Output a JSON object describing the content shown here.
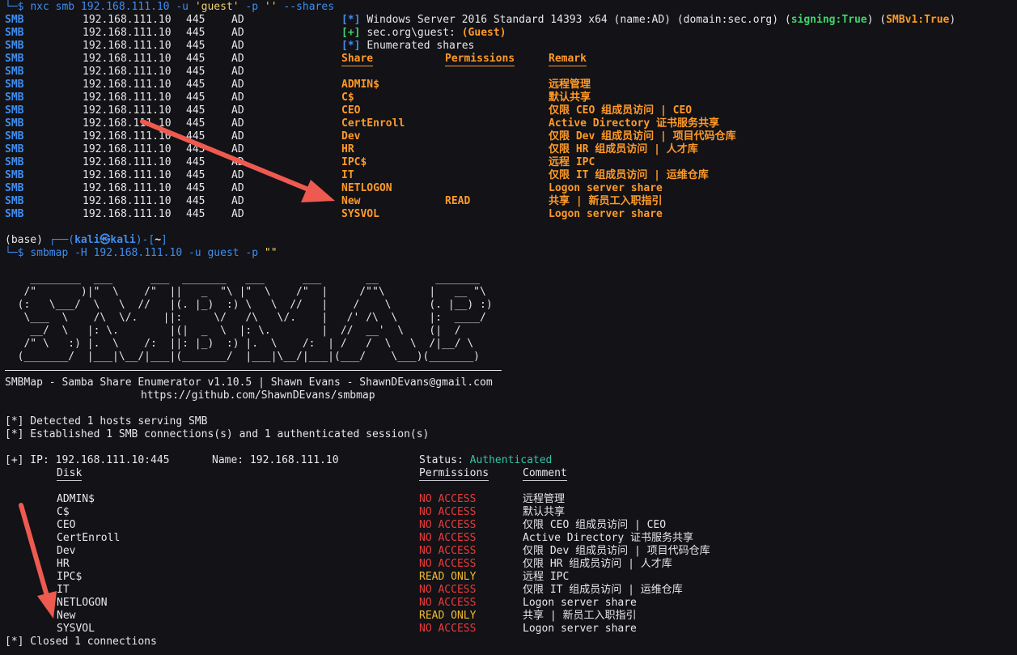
{
  "cmd1": {
    "prompt": "└─$ ",
    "command": "nxc smb 192.168.111.10 -u ",
    "user_arg": "'guest'",
    "mid": " -p ",
    "pass_arg": "''",
    "tail": " --shares"
  },
  "smb_proto": "SMB",
  "smb_ip": "192.168.111.10",
  "smb_port": "445",
  "smb_host": "AD",
  "nxc": {
    "info_tag": "[*]",
    "os_text": "Windows Server 2016 Standard 14393 x64 (name:AD) (domain:sec.org) (",
    "signing": "signing:True",
    "sep": ") (",
    "smbv1": "SMBv1:True",
    "close": ")",
    "plus_tag": "[+]",
    "login": "sec.org\\guest: ",
    "guest": "(Guest)",
    "enum_tag": "[*]",
    "enum": "Enumerated shares",
    "headers": [
      "Share",
      "Permissions",
      "Remark"
    ],
    "shares": [
      {
        "share": "ADMIN$",
        "perm": "",
        "remark": "远程管理"
      },
      {
        "share": "C$",
        "perm": "",
        "remark": "默认共享"
      },
      {
        "share": "CEO",
        "perm": "",
        "remark": "仅限 CEO 组成员访问 | CEO"
      },
      {
        "share": "CertEnroll",
        "perm": "",
        "remark": "Active Directory 证书服务共享"
      },
      {
        "share": "Dev",
        "perm": "",
        "remark": "仅限 Dev 组成员访问 | 项目代码仓库"
      },
      {
        "share": "HR",
        "perm": "",
        "remark": "仅限 HR 组成员访问 | 人才库"
      },
      {
        "share": "IPC$",
        "perm": "",
        "remark": "远程 IPC"
      },
      {
        "share": "IT",
        "perm": "",
        "remark": "仅限 IT 组成员访问 | 运维仓库"
      },
      {
        "share": "NETLOGON",
        "perm": "",
        "remark": "Logon server share"
      },
      {
        "share": "New",
        "perm": "READ",
        "remark": "共享 | 新员工入职指引"
      },
      {
        "share": "SYSVOL",
        "perm": "",
        "remark": "Logon server share"
      }
    ]
  },
  "prompt2": {
    "base": "(base) ",
    "open": "┌──(",
    "user": "kali㉿kali",
    "close": ")-[",
    "dir": "~",
    "end": "]",
    "arrow": "└─$ ",
    "command": "smbmap -H 192.168.111.10 -u guest -p ",
    "arg": "\"\""
  },
  "banner": [
    "    ________  ___      ___  _______   ___      ___       __         _______",
    "   /\"       )|\"  \\    /\"  ||   _  \"\\ |\"  \\    /\"  |     /\"\"\\       |   __ \"\\",
    "  (:   \\___/  \\   \\  //   |(. |_)  :) \\   \\  //   |    /    \\      (. |__) :)",
    "   \\___  \\    /\\  \\/.    ||:     \\/   /\\   \\/.    |   /' /\\  \\     |:  ____/",
    "    __/  \\   |: \\.        |(|  _  \\  |: \\.        |  //  __'  \\    (|  /",
    "   /\" \\   :) |.  \\    /:  ||: |_)  :) |.  \\    /:  | /   /  \\   \\  /|__/ \\",
    "  (_______/  |___|\\__/|___|(_______/  |___|\\__/|___|(___/    \\___)(_______)"
  ],
  "smbmap": {
    "title": "SMBMap - Samba Share Enumerator v1.10.5 | Shawn Evans - ShawnDEvans@gmail.com",
    "url": "https://github.com/ShawnDEvans/smbmap",
    "detected": "[*] Detected 1 hosts serving SMB",
    "established": "[*] Established 1 SMB connections(s) and 1 authenticated session(s)",
    "ip_line": "[+] IP: 192.168.111.10:445",
    "name_line": "Name: 192.168.111.10",
    "status_label": "Status: ",
    "status_value": "Authenticated",
    "headers": [
      "Disk",
      "Permissions",
      "Comment"
    ],
    "shares": [
      {
        "disk": "ADMIN$",
        "perm": "NO ACCESS",
        "comment": "远程管理"
      },
      {
        "disk": "C$",
        "perm": "NO ACCESS",
        "comment": "默认共享"
      },
      {
        "disk": "CEO",
        "perm": "NO ACCESS",
        "comment": "仅限 CEO 组成员访问 | CEO"
      },
      {
        "disk": "CertEnroll",
        "perm": "NO ACCESS",
        "comment": "Active Directory 证书服务共享"
      },
      {
        "disk": "Dev",
        "perm": "NO ACCESS",
        "comment": "仅限 Dev 组成员访问 | 项目代码仓库"
      },
      {
        "disk": "HR",
        "perm": "NO ACCESS",
        "comment": "仅限 HR 组成员访问 | 人才库"
      },
      {
        "disk": "IPC$",
        "perm": "READ ONLY",
        "comment": "远程 IPC"
      },
      {
        "disk": "IT",
        "perm": "NO ACCESS",
        "comment": "仅限 IT 组成员访问 | 运维仓库"
      },
      {
        "disk": "NETLOGON",
        "perm": "NO ACCESS",
        "comment": "Logon server share"
      },
      {
        "disk": "New",
        "perm": "READ ONLY",
        "comment": "共享 | 新员工入职指引"
      },
      {
        "disk": "SYSVOL",
        "perm": "NO ACCESS",
        "comment": "Logon server share"
      }
    ],
    "closed": "[*] Closed 1 connections"
  },
  "colors": {
    "background": "#121217",
    "accent_blue": "#3f8ef0",
    "success_green": "#3fd46a",
    "highlight_orange": "#ff9a28",
    "error_red": "#e83b3b",
    "readonly_yellow": "#f3b92e",
    "authenticated_teal": "#38c3a6",
    "annotation_arrow": "#ee5a4f"
  }
}
